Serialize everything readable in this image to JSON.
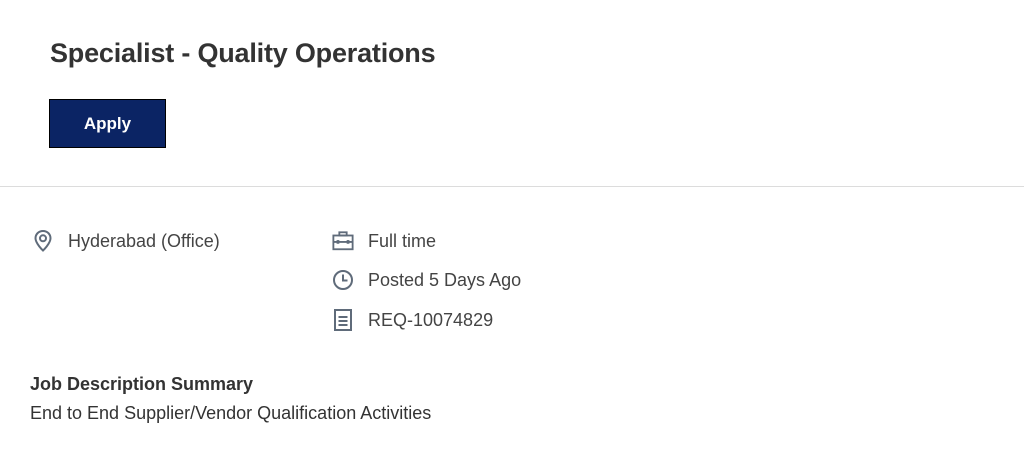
{
  "job": {
    "title": "Specialist - Quality Operations",
    "apply_label": "Apply"
  },
  "details": {
    "location": {
      "icon": "location-pin-icon",
      "text": "Hyderabad (Office)"
    },
    "time_type": {
      "icon": "briefcase-icon",
      "text": "Full time"
    },
    "posted": {
      "icon": "clock-icon",
      "text": "Posted 5 Days Ago"
    },
    "requisition": {
      "icon": "document-icon",
      "text": "REQ-10074829"
    }
  },
  "summary": {
    "heading": "Job Description Summary",
    "text": "End to End Supplier/Vendor Qualification Activities"
  },
  "colors": {
    "apply_button_bg": "#0b2464",
    "icon_color": "#5f6b7a",
    "text": "#333333"
  }
}
